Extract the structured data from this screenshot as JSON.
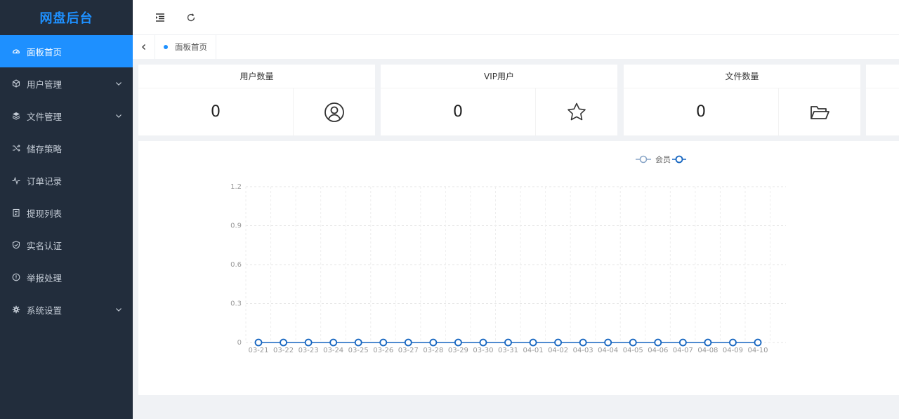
{
  "sidebar": {
    "brand": "网盘后台",
    "items": [
      {
        "label": "面板首页",
        "icon": "dashboard-icon",
        "active": true,
        "has_children": false
      },
      {
        "label": "用户管理",
        "icon": "cube-icon",
        "active": false,
        "has_children": true
      },
      {
        "label": "文件管理",
        "icon": "layers-icon",
        "active": false,
        "has_children": true
      },
      {
        "label": "储存策略",
        "icon": "shuffle-icon",
        "active": false,
        "has_children": false
      },
      {
        "label": "订单记录",
        "icon": "pulse-icon",
        "active": false,
        "has_children": false
      },
      {
        "label": "提现列表",
        "icon": "clipboard-icon",
        "active": false,
        "has_children": false
      },
      {
        "label": "实名认证",
        "icon": "shield-check-icon",
        "active": false,
        "has_children": false
      },
      {
        "label": "举报处理",
        "icon": "alert-circle-icon",
        "active": false,
        "has_children": false
      },
      {
        "label": "系统设置",
        "icon": "gear-icon",
        "active": false,
        "has_children": true
      }
    ]
  },
  "topbar": {
    "toggle_icon": "menu-fold-icon",
    "refresh_icon": "refresh-icon"
  },
  "tabs": [
    {
      "label": "面板首页",
      "active": true
    }
  ],
  "stats": [
    {
      "title": "用户数量",
      "value": "0",
      "icon": "user-circle-icon"
    },
    {
      "title": "VIP用户",
      "value": "0",
      "icon": "star-icon"
    },
    {
      "title": "文件数量",
      "value": "0",
      "icon": "folder-open-icon"
    }
  ],
  "colors": {
    "accent": "#1e90ff",
    "sidebar_bg": "#222d3c",
    "series_line": "#1565c0"
  },
  "chart_data": {
    "type": "line",
    "legend": {
      "position": "top-center",
      "entries": [
        "会员"
      ]
    },
    "x": [
      "03-21",
      "03-22",
      "03-23",
      "03-24",
      "03-25",
      "03-26",
      "03-27",
      "03-28",
      "03-29",
      "03-30",
      "03-31",
      "04-01",
      "04-02",
      "04-03",
      "04-04",
      "04-05",
      "04-06",
      "04-07",
      "04-08",
      "04-09",
      "04-10"
    ],
    "series": [
      {
        "name": "会员",
        "values": [
          0,
          0,
          0,
          0,
          0,
          0,
          0,
          0,
          0,
          0,
          0,
          0,
          0,
          0,
          0,
          0,
          0,
          0,
          0,
          0,
          0
        ]
      }
    ],
    "ylim": [
      0,
      1.2
    ],
    "yticks": [
      "0",
      "0.3",
      "0.6",
      "0.9",
      "1.2"
    ],
    "grid": true
  }
}
